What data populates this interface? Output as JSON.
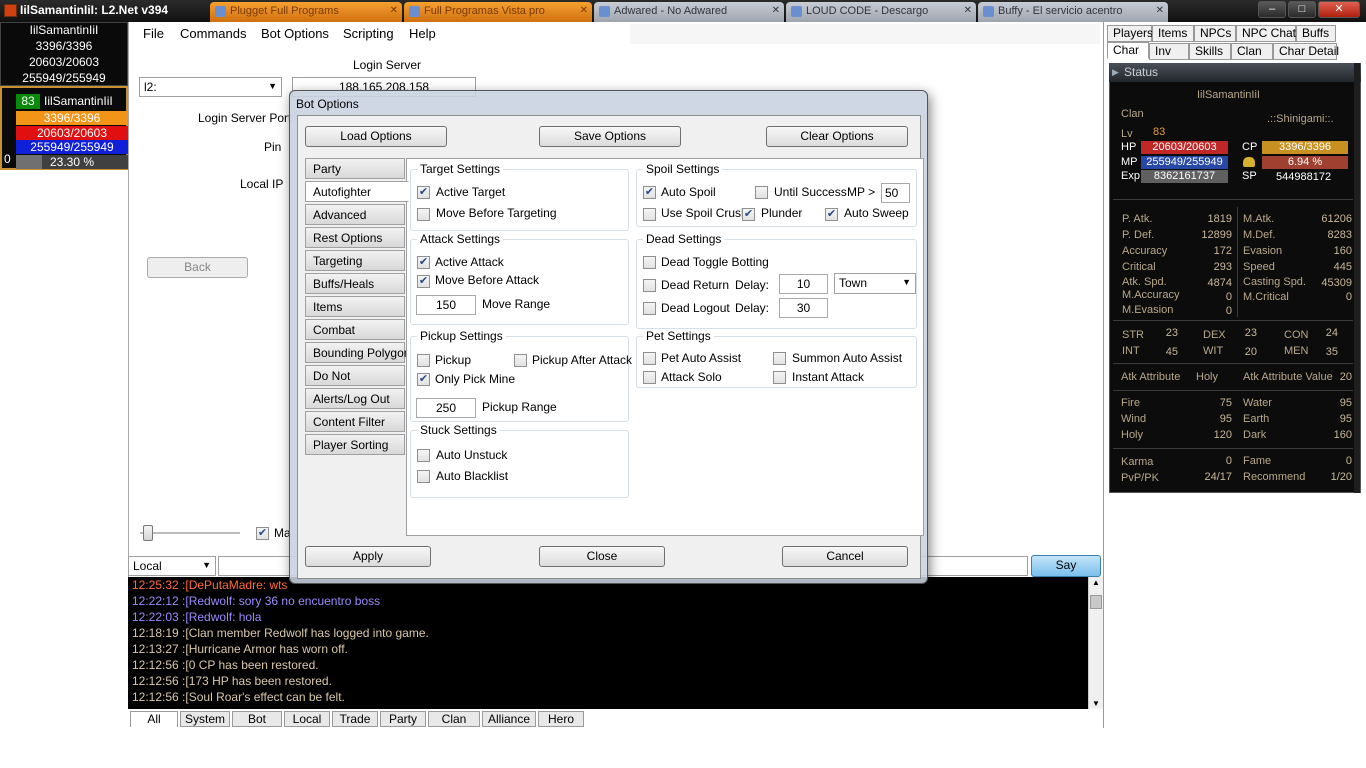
{
  "window": {
    "title": "IilSamantinIiI: L2.Net v394",
    "taskbar_tabs": [
      {
        "label": "Plugget Full Programs",
        "style": "orange"
      },
      {
        "label": "Full Programas Vista pro",
        "style": "orange"
      },
      {
        "label": "Adwared - No Adwared",
        "style": "gray"
      },
      {
        "label": "LOUD CODE - Descargo",
        "style": "gray"
      },
      {
        "label": "Buffy - El servicio acentro",
        "style": "gray"
      }
    ],
    "minimize": "–",
    "maximize": "□",
    "close": "✕"
  },
  "char_panel": {
    "name": "IilSamantinIiI",
    "cp": "3396/3396",
    "hp": "20603/20603",
    "mp": "255949/255949"
  },
  "party_panel": {
    "level": "83",
    "name": "IilSamantinIiI",
    "cp": "3396/3396",
    "hp": "20603/20603",
    "mp": "255949/255949",
    "exp": "23.30 %",
    "index": "0",
    "colors": {
      "cp": "#f29418",
      "hp": "#e01010",
      "mp": "#1020d8",
      "exp": "#707070"
    }
  },
  "menu": [
    "File",
    "Commands",
    "Bot Options",
    "Scripting",
    "Help"
  ],
  "login": {
    "server_select": "l2:",
    "login_server_label": "Login Server",
    "login_server_value": "188.165.208.158",
    "login_port_label": "Login Server Port",
    "pin_label": "Pin",
    "local_ip_label": "Local IP",
    "back_button": "Back",
    "ma_label": "Ma"
  },
  "dialog": {
    "title": "Bot Options",
    "load": "Load Options",
    "save": "Save Options",
    "clear": "Clear Options",
    "apply": "Apply",
    "close": "Close",
    "cancel": "Cancel",
    "nav": [
      "Party",
      "Autofighter",
      "Advanced",
      "Rest Options",
      "Targeting",
      "Buffs/Heals",
      "Items",
      "Combat",
      "Bounding Polygon",
      "Do Not",
      "Alerts/Log Out",
      "Content Filter",
      "Player Sorting"
    ],
    "active_nav": "Autofighter",
    "target": {
      "title": "Target Settings",
      "active_target": "Active Target",
      "move_before_targeting": "Move Before Targeting"
    },
    "attack": {
      "title": "Attack Settings",
      "active_attack": "Active Attack",
      "move_before_attack": "Move Before Attack",
      "move_range_value": "150",
      "move_range_label": "Move Range"
    },
    "pickup": {
      "title": "Pickup Settings",
      "pickup": "Pickup",
      "pickup_after_attack": "Pickup After Attack",
      "only_pick_mine": "Only Pick Mine",
      "range_value": "250",
      "range_label": "Pickup Range"
    },
    "stuck": {
      "title": "Stuck Settings",
      "auto_unstuck": "Auto Unstuck",
      "auto_blacklist": "Auto Blacklist"
    },
    "spoil": {
      "title": "Spoil Settings",
      "auto_spoil": "Auto Spoil",
      "until_success": "Until Success",
      "mp_label": "MP >",
      "mp_value": "50",
      "use_spoil_crush": "Use Spoil Crush",
      "plunder": "Plunder",
      "auto_sweep": "Auto Sweep"
    },
    "dead": {
      "title": "Dead Settings",
      "toggle_botting": "Dead Toggle Botting",
      "dead_return": "Dead Return",
      "delay_label": "Delay:",
      "return_delay": "10",
      "return_target": "Town",
      "dead_logout": "Dead Logout",
      "logout_delay": "30"
    },
    "pet": {
      "title": "Pet Settings",
      "pet_auto_assist": "Pet Auto Assist",
      "summon_auto_assist": "Summon Auto Assist",
      "attack_solo": "Attack Solo",
      "instant_attack": "Instant Attack"
    }
  },
  "chat": {
    "channel": "Local",
    "say_button": "Say",
    "lines": [
      {
        "text": "12:25:32 :[DePutaMadre: wts",
        "color": "#ff6a3a"
      },
      {
        "text": "12:22:12 :[Redwolf: sory 36 no encuentro boss",
        "color": "#9a8cff"
      },
      {
        "text": "12:22:03 :[Redwolf: hola",
        "color": "#9a8cff"
      },
      {
        "text": "12:18:19 :[Clan member Redwolf has logged into game.",
        "color": "#d8c8a8"
      },
      {
        "text": "12:13:27 :[Hurricane Armor has worn off.",
        "color": "#d8c8a8"
      },
      {
        "text": "12:12:56 :[0 CP has been restored.",
        "color": "#d8c8a8"
      },
      {
        "text": "12:12:56 :[173 HP has been restored.",
        "color": "#d8c8a8"
      },
      {
        "text": "12:12:56 :[Soul Roar's effect can be felt.",
        "color": "#d8c8a8"
      }
    ],
    "tabs": [
      "All",
      "System",
      "Bot",
      "Local",
      "Trade",
      "Party",
      "Clan",
      "Alliance",
      "Hero"
    ]
  },
  "right_tabs": {
    "row1": [
      "Players",
      "Items",
      "NPCs",
      "NPC Chat",
      "Buffs"
    ],
    "row2": [
      "Char",
      "Inv",
      "Skills",
      "Clan",
      "Char Detail"
    ]
  },
  "status": {
    "header": "Status",
    "name": "IilSamantinIiI",
    "clan_label": "Clan",
    "clan_value": ".::Shinigami::.",
    "lv_label": "Lv",
    "lv_value": "83",
    "hp_label": "HP",
    "hp_value": "20603/20603",
    "cp_label": "CP",
    "cp_value": "3396/3396",
    "mp_label": "MP",
    "mp_value": "255949/255949",
    "pct_value": "6.94 %",
    "exp_label": "Exp",
    "exp_value": "8362161737",
    "sp_label": "SP",
    "sp_value": "544988172",
    "combat_left": [
      {
        "label": "P. Atk.",
        "value": "1819"
      },
      {
        "label": "P. Def.",
        "value": "12899"
      },
      {
        "label": "Accuracy",
        "value": "172"
      },
      {
        "label": "Critical",
        "value": "293"
      },
      {
        "label": "Atk. Spd.",
        "value": "4874"
      },
      {
        "label": "M.Accuracy",
        "value": "0"
      },
      {
        "label": "M.Evasion",
        "value": "0"
      }
    ],
    "combat_right": [
      {
        "label": "M.Atk.",
        "value": "61206"
      },
      {
        "label": "M.Def.",
        "value": "8283"
      },
      {
        "label": "Evasion",
        "value": "160"
      },
      {
        "label": "Speed",
        "value": "445"
      },
      {
        "label": "Casting Spd.",
        "value": "45309"
      },
      {
        "label": "M.Critical",
        "value": "0"
      }
    ],
    "base": [
      {
        "label": "STR",
        "value": "23"
      },
      {
        "label": "DEX",
        "value": "23"
      },
      {
        "label": "CON",
        "value": "24"
      },
      {
        "label": "INT",
        "value": "45"
      },
      {
        "label": "WIT",
        "value": "20"
      },
      {
        "label": "MEN",
        "value": "35"
      }
    ],
    "atk_attr_label": "Atk Attribute",
    "atk_attr_value": "Holy",
    "atk_attr_val_label": "Atk Attribute Value",
    "atk_attr_val_value": "20",
    "elements_left": [
      {
        "label": "Fire",
        "value": "75"
      },
      {
        "label": "Wind",
        "value": "95"
      },
      {
        "label": "Holy",
        "value": "120"
      }
    ],
    "elements_right": [
      {
        "label": "Water",
        "value": "95"
      },
      {
        "label": "Earth",
        "value": "95"
      },
      {
        "label": "Dark",
        "value": "160"
      }
    ],
    "karma_label": "Karma",
    "karma_value": "0",
    "fame_label": "Fame",
    "fame_value": "0",
    "pvp_label": "PvP/PK",
    "pvp_value": "24/17",
    "rec_label": "Recommend",
    "rec_value": "1/20",
    "colors": {
      "hp": "#c02828",
      "cp": "#c89020",
      "mp": "#2848a8",
      "exp": "#606060"
    }
  }
}
